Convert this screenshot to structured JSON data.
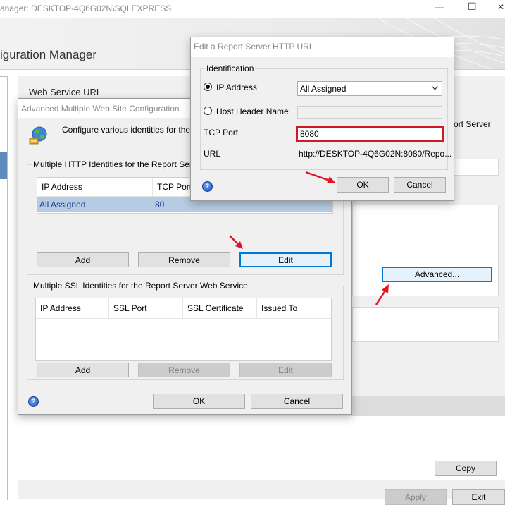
{
  "main_window": {
    "title_partial": "anager: DESKTOP-4Q6G02N\\SQLEXPRESS",
    "header_partial": "iguration Manager",
    "section_title": "Web Service URL",
    "desc_partial": "ort Server",
    "advanced_label": "Advanced...",
    "copy_label": "Copy",
    "apply_label": "Apply",
    "exit_label": "Exit",
    "minimize_glyph": "—",
    "maximize_glyph": "☐",
    "close_glyph": "✕"
  },
  "advanced_dialog": {
    "title": "Advanced Multiple Web Site Configuration",
    "intro": "Configure various identities for the Re",
    "http_group_label": "Multiple HTTP Identities for the Report Server W",
    "http_columns": [
      "IP Address",
      "TCP Port"
    ],
    "http_rows": [
      {
        "ip": "All Assigned",
        "port": "80"
      }
    ],
    "http_add": "Add",
    "http_remove": "Remove",
    "http_edit": "Edit",
    "ssl_group_label": "Multiple SSL Identities for the Report Server Web Service",
    "ssl_columns": [
      "IP Address",
      "SSL Port",
      "SSL Certificate",
      "Issued To"
    ],
    "ssl_add": "Add",
    "ssl_remove": "Remove",
    "ssl_edit": "Edit",
    "ok": "OK",
    "cancel": "Cancel",
    "help": "?"
  },
  "edit_dialog": {
    "title": "Edit a Report Server HTTP URL",
    "group_label": "Identification",
    "ip_address_label": "IP Address",
    "ip_address_value": "All Assigned",
    "host_header_label": "Host Header Name",
    "host_header_value": "",
    "tcp_port_label": "TCP Port",
    "tcp_port_value": "8080",
    "url_label": "URL",
    "url_value": "http://DESKTOP-4Q6G02N:8080/Repo...",
    "ok": "OK",
    "cancel": "Cancel",
    "help": "?"
  },
  "colors": {
    "annotation_red": "#e81123",
    "focus_blue": "#0078d7",
    "selection_blue": "#b6cce4"
  }
}
